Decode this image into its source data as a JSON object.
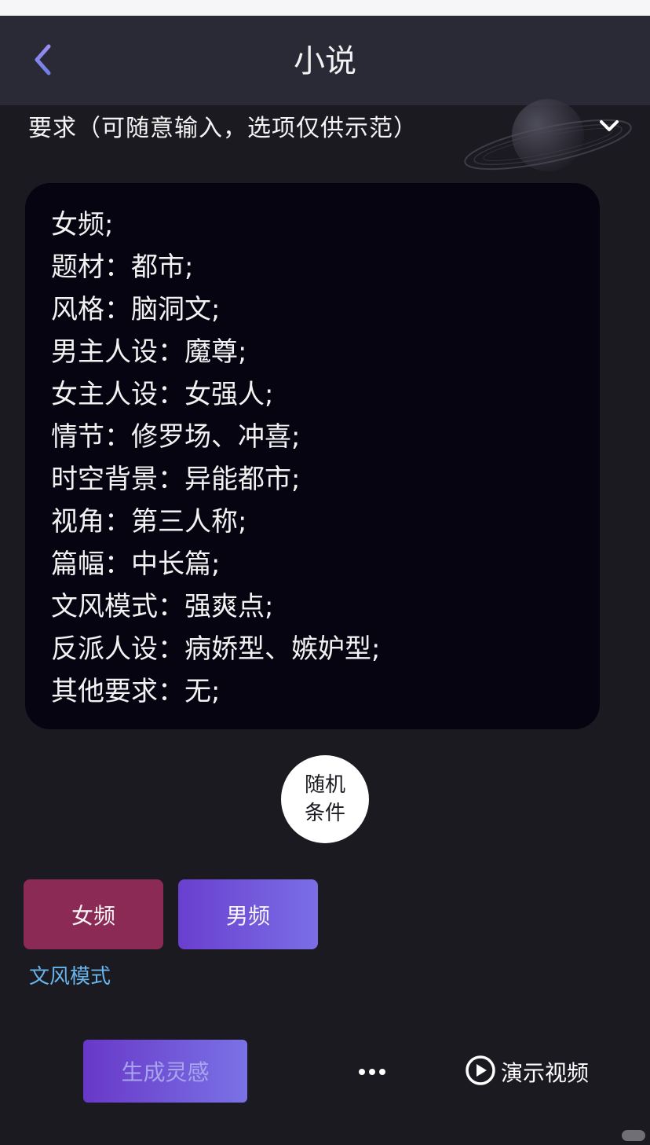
{
  "header": {
    "title": "小说",
    "back_icon": "chevron-left-icon"
  },
  "requirements": {
    "label": "要求（可随意输入，选项仅供示范）",
    "toggle_icon": "chevron-down-icon",
    "lines": [
      "女频;",
      "题材：都市;",
      "风格：脑洞文;",
      "男主人设：魔尊;",
      "女主人设：女强人;",
      "情节：修罗场、冲喜;",
      "时空背景：异能都市;",
      "视角：第三人称;",
      "篇幅：中长篇;",
      "文风模式：强爽点;",
      "反派人设：病娇型、嫉妒型;",
      "其他要求：无;"
    ]
  },
  "random_button": {
    "line1": "随机",
    "line2": "条件"
  },
  "gender_options": {
    "female": "女频",
    "male": "男频"
  },
  "style_mode_link": "文风模式",
  "footer": {
    "generate_label": "生成灵感",
    "more_icon": "more-dots-icon",
    "demo_icon": "play-circle-icon",
    "demo_label": "演示视频"
  },
  "colors": {
    "background": "#1b1a21",
    "nav_background": "#2a2936",
    "text_box": "#050410",
    "female_button": "#8b2a55",
    "male_button_gradient": [
      "#6a3fcf",
      "#7a6ee6"
    ],
    "link": "#67b4ea",
    "back_arrow": "#8a7cf0"
  }
}
